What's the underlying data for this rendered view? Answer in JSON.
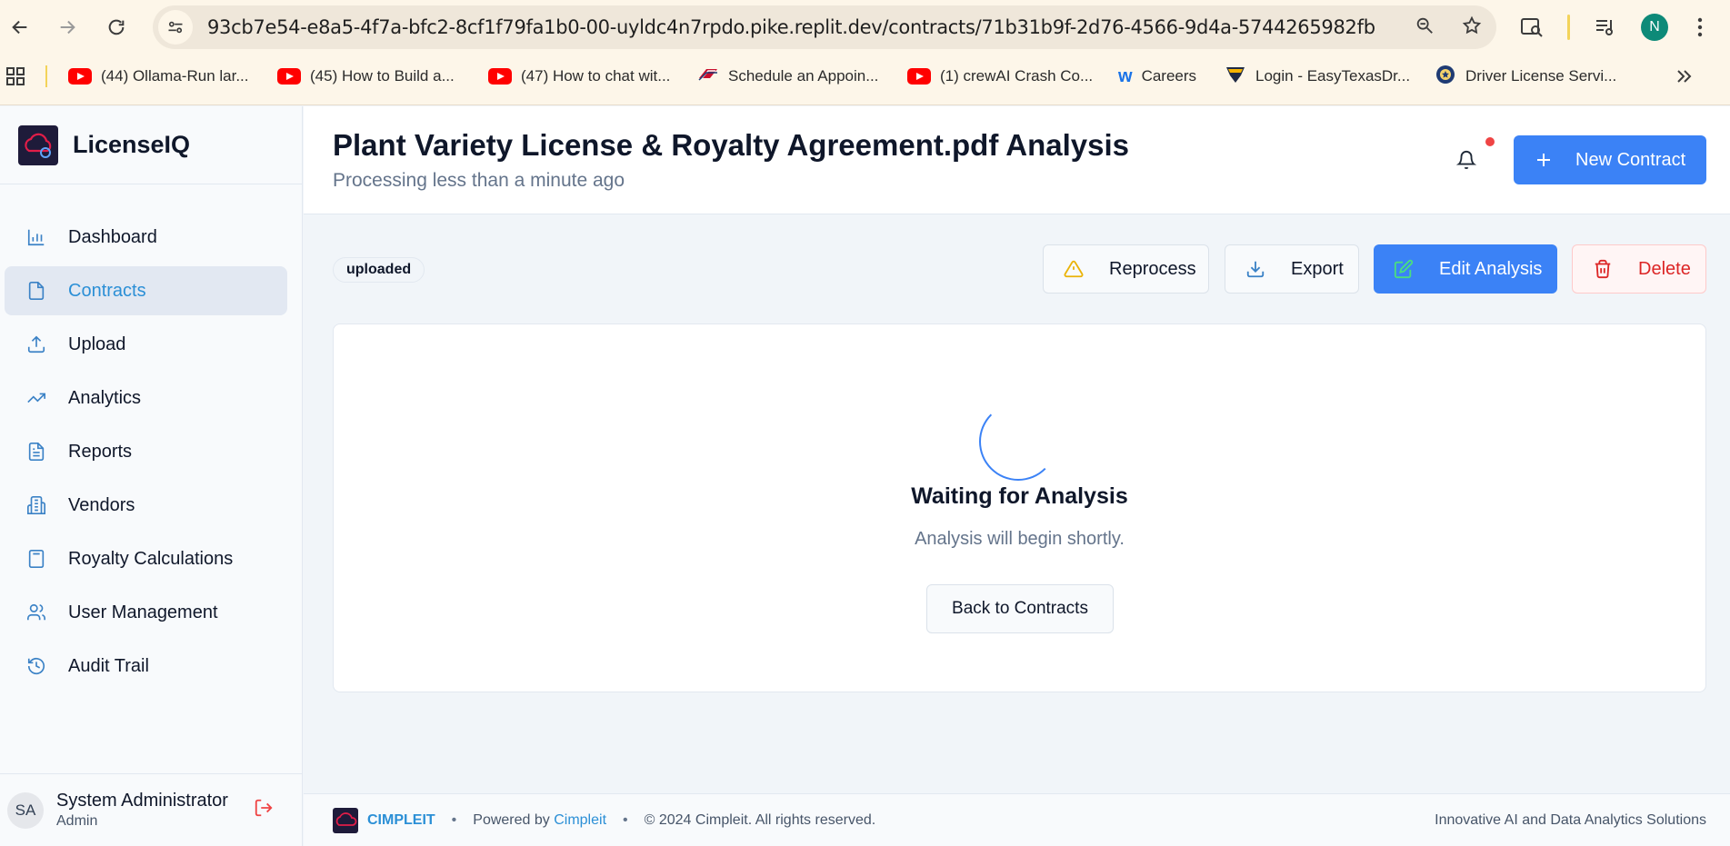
{
  "browser": {
    "url": "93cb7e54-e8a5-4f7a-bfc2-8cf1f79fa1b0-00-uyldc4n7rpdo.pike.replit.dev/contracts/71b31b9f-2d76-4566-9d4a-5744265982fb",
    "profile_initial": "N",
    "bookmarks": [
      {
        "label": "(44) Ollama-Run lar...",
        "icon": "youtube-icon"
      },
      {
        "label": "(45) How to Build a...",
        "icon": "youtube-icon"
      },
      {
        "label": "(47) How to chat wit...",
        "icon": "youtube-icon"
      },
      {
        "label": "Schedule an Appoin...",
        "icon": "flag-icon"
      },
      {
        "label": "(1) crewAI Crash Co...",
        "icon": "youtube-icon"
      },
      {
        "label": "Careers",
        "icon": "w-icon"
      },
      {
        "label": "Login - EasyTexasDr...",
        "icon": "shield-icon"
      },
      {
        "label": "Driver License Servi...",
        "icon": "seal-icon"
      }
    ]
  },
  "app": {
    "brand": "LicenseIQ"
  },
  "sidebar": {
    "items": [
      {
        "label": "Dashboard",
        "icon": "bar-chart-icon"
      },
      {
        "label": "Contracts",
        "icon": "file-icon"
      },
      {
        "label": "Upload",
        "icon": "upload-icon"
      },
      {
        "label": "Analytics",
        "icon": "trending-up-icon"
      },
      {
        "label": "Reports",
        "icon": "file-text-icon"
      },
      {
        "label": "Vendors",
        "icon": "building-icon"
      },
      {
        "label": "Royalty Calculations",
        "icon": "calculator-icon"
      },
      {
        "label": "User Management",
        "icon": "users-icon"
      },
      {
        "label": "Audit Trail",
        "icon": "history-icon"
      }
    ],
    "active_index": 1,
    "user": {
      "initials": "SA",
      "name": "System Administrator",
      "role": "Admin"
    }
  },
  "header": {
    "title": "Plant Variety License & Royalty Agreement.pdf Analysis",
    "subtitle": "Processing less than a minute ago",
    "new_contract_label": "New Contract"
  },
  "toolbar": {
    "status_badge": "uploaded",
    "reprocess_label": "Reprocess",
    "export_label": "Export",
    "edit_label": "Edit Analysis",
    "delete_label": "Delete"
  },
  "card": {
    "title": "Waiting for Analysis",
    "subtitle": "Analysis will begin shortly.",
    "back_label": "Back to Contracts"
  },
  "footer": {
    "brand": "CIMPLEIT",
    "powered_prefix": "Powered by ",
    "powered_link": "Cimpleit",
    "copyright": "© 2024 Cimpleit. All rights reserved.",
    "tagline": "Innovative AI and Data Analytics Solutions"
  },
  "colors": {
    "primary": "#3b82f6",
    "active_text": "#2b8fd6",
    "danger": "#dc2626"
  }
}
